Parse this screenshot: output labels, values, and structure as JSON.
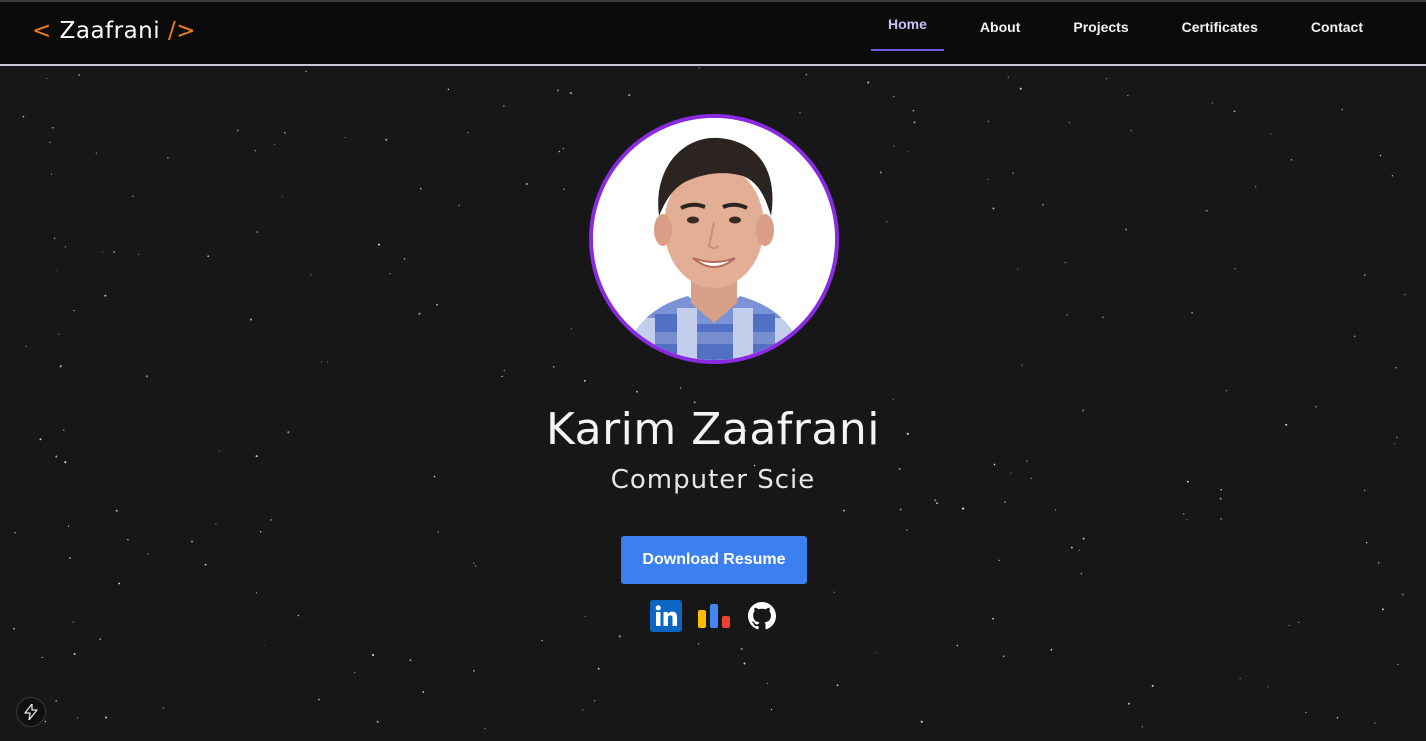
{
  "header": {
    "logo": {
      "open": "<",
      "name": "Zaafrani",
      "close": "/>"
    },
    "nav": [
      {
        "label": "Home",
        "active": true
      },
      {
        "label": "About",
        "active": false
      },
      {
        "label": "Projects",
        "active": false
      },
      {
        "label": "Certificates",
        "active": false
      },
      {
        "label": "Contact",
        "active": false
      }
    ]
  },
  "hero": {
    "name": "Karim Zaafrani",
    "subtitle": "Computer Scie",
    "resume_button": "Download Resume",
    "avatar_icon": "profile-photo",
    "socials": [
      {
        "icon": "linkedin-icon",
        "label": "in"
      },
      {
        "icon": "analytics-icon"
      },
      {
        "icon": "github-icon"
      }
    ]
  },
  "colors": {
    "accent_orange": "#f07c1c",
    "avatar_ring": "#8a2be2",
    "button_blue": "#3b7ff0",
    "nav_active": "#6b5fe0",
    "background": "#171718"
  },
  "corner_badge_icon": "lightning-icon"
}
